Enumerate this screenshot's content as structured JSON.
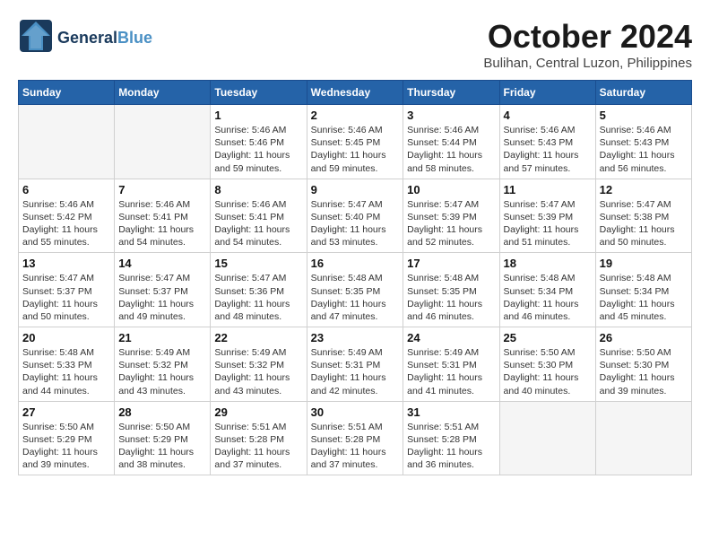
{
  "header": {
    "logo_line1": "General",
    "logo_line2": "Blue",
    "month": "October 2024",
    "location": "Bulihan, Central Luzon, Philippines"
  },
  "weekdays": [
    "Sunday",
    "Monday",
    "Tuesday",
    "Wednesday",
    "Thursday",
    "Friday",
    "Saturday"
  ],
  "weeks": [
    [
      {
        "day": "",
        "empty": true
      },
      {
        "day": "",
        "empty": true
      },
      {
        "day": "1",
        "sunrise": "5:46 AM",
        "sunset": "5:46 PM",
        "daylight": "11 hours and 59 minutes."
      },
      {
        "day": "2",
        "sunrise": "5:46 AM",
        "sunset": "5:45 PM",
        "daylight": "11 hours and 59 minutes."
      },
      {
        "day": "3",
        "sunrise": "5:46 AM",
        "sunset": "5:44 PM",
        "daylight": "11 hours and 58 minutes."
      },
      {
        "day": "4",
        "sunrise": "5:46 AM",
        "sunset": "5:43 PM",
        "daylight": "11 hours and 57 minutes."
      },
      {
        "day": "5",
        "sunrise": "5:46 AM",
        "sunset": "5:43 PM",
        "daylight": "11 hours and 56 minutes."
      }
    ],
    [
      {
        "day": "6",
        "sunrise": "5:46 AM",
        "sunset": "5:42 PM",
        "daylight": "11 hours and 55 minutes."
      },
      {
        "day": "7",
        "sunrise": "5:46 AM",
        "sunset": "5:41 PM",
        "daylight": "11 hours and 54 minutes."
      },
      {
        "day": "8",
        "sunrise": "5:46 AM",
        "sunset": "5:41 PM",
        "daylight": "11 hours and 54 minutes."
      },
      {
        "day": "9",
        "sunrise": "5:47 AM",
        "sunset": "5:40 PM",
        "daylight": "11 hours and 53 minutes."
      },
      {
        "day": "10",
        "sunrise": "5:47 AM",
        "sunset": "5:39 PM",
        "daylight": "11 hours and 52 minutes."
      },
      {
        "day": "11",
        "sunrise": "5:47 AM",
        "sunset": "5:39 PM",
        "daylight": "11 hours and 51 minutes."
      },
      {
        "day": "12",
        "sunrise": "5:47 AM",
        "sunset": "5:38 PM",
        "daylight": "11 hours and 50 minutes."
      }
    ],
    [
      {
        "day": "13",
        "sunrise": "5:47 AM",
        "sunset": "5:37 PM",
        "daylight": "11 hours and 50 minutes."
      },
      {
        "day": "14",
        "sunrise": "5:47 AM",
        "sunset": "5:37 PM",
        "daylight": "11 hours and 49 minutes."
      },
      {
        "day": "15",
        "sunrise": "5:47 AM",
        "sunset": "5:36 PM",
        "daylight": "11 hours and 48 minutes."
      },
      {
        "day": "16",
        "sunrise": "5:48 AM",
        "sunset": "5:35 PM",
        "daylight": "11 hours and 47 minutes."
      },
      {
        "day": "17",
        "sunrise": "5:48 AM",
        "sunset": "5:35 PM",
        "daylight": "11 hours and 46 minutes."
      },
      {
        "day": "18",
        "sunrise": "5:48 AM",
        "sunset": "5:34 PM",
        "daylight": "11 hours and 46 minutes."
      },
      {
        "day": "19",
        "sunrise": "5:48 AM",
        "sunset": "5:34 PM",
        "daylight": "11 hours and 45 minutes."
      }
    ],
    [
      {
        "day": "20",
        "sunrise": "5:48 AM",
        "sunset": "5:33 PM",
        "daylight": "11 hours and 44 minutes."
      },
      {
        "day": "21",
        "sunrise": "5:49 AM",
        "sunset": "5:32 PM",
        "daylight": "11 hours and 43 minutes."
      },
      {
        "day": "22",
        "sunrise": "5:49 AM",
        "sunset": "5:32 PM",
        "daylight": "11 hours and 43 minutes."
      },
      {
        "day": "23",
        "sunrise": "5:49 AM",
        "sunset": "5:31 PM",
        "daylight": "11 hours and 42 minutes."
      },
      {
        "day": "24",
        "sunrise": "5:49 AM",
        "sunset": "5:31 PM",
        "daylight": "11 hours and 41 minutes."
      },
      {
        "day": "25",
        "sunrise": "5:50 AM",
        "sunset": "5:30 PM",
        "daylight": "11 hours and 40 minutes."
      },
      {
        "day": "26",
        "sunrise": "5:50 AM",
        "sunset": "5:30 PM",
        "daylight": "11 hours and 39 minutes."
      }
    ],
    [
      {
        "day": "27",
        "sunrise": "5:50 AM",
        "sunset": "5:29 PM",
        "daylight": "11 hours and 39 minutes."
      },
      {
        "day": "28",
        "sunrise": "5:50 AM",
        "sunset": "5:29 PM",
        "daylight": "11 hours and 38 minutes."
      },
      {
        "day": "29",
        "sunrise": "5:51 AM",
        "sunset": "5:28 PM",
        "daylight": "11 hours and 37 minutes."
      },
      {
        "day": "30",
        "sunrise": "5:51 AM",
        "sunset": "5:28 PM",
        "daylight": "11 hours and 37 minutes."
      },
      {
        "day": "31",
        "sunrise": "5:51 AM",
        "sunset": "5:28 PM",
        "daylight": "11 hours and 36 minutes."
      },
      {
        "day": "",
        "empty": true
      },
      {
        "day": "",
        "empty": true
      }
    ]
  ]
}
